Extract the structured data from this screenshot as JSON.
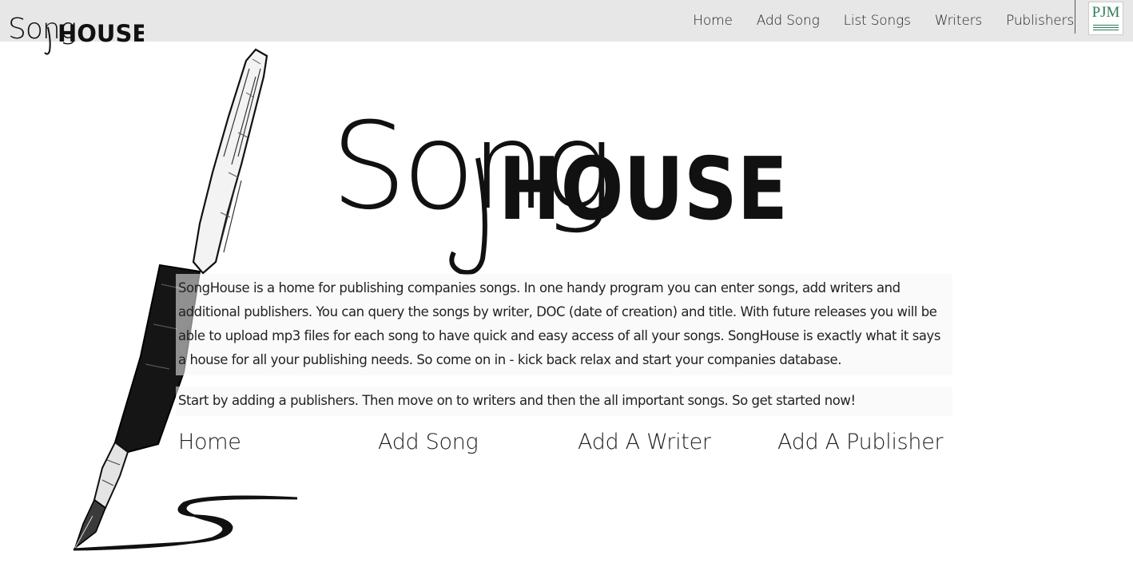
{
  "brand": {
    "logo_text_script": "Song",
    "logo_text_block": "HOUSE",
    "icon": "songhouse-logo"
  },
  "nav": {
    "items": [
      {
        "label": "Home"
      },
      {
        "label": "Add Song"
      },
      {
        "label": "List Songs"
      },
      {
        "label": "Writers"
      },
      {
        "label": "Publishers"
      }
    ],
    "partner_logo_text": "PJM"
  },
  "hero": {
    "logo_text_script": "Song",
    "logo_text_block": "HOUSE",
    "icon": "fountain-pen-illustration"
  },
  "intro": {
    "paragraph_1": "SongHouse is a home for publishing companies songs. In one handy program you can enter songs, add writers and additional publishers. You can query the songs by writer, DOC (date of creation) and title. With future releases you will be able to upload mp3 files for each song to have quick and easy access of all your songs. SongHouse is exactly what it says a house for all your publishing needs. So come on in - kick back relax and start your companies database.",
    "paragraph_2": "Start by adding a publishers. Then move on to writers and then the all important songs. So get started now!"
  },
  "bottom_links": {
    "home": "Home",
    "add_song": "Add Song",
    "add_writer": "Add A Writer",
    "add_publisher": "Add A Publisher"
  },
  "colors": {
    "navbar_bg": "#e7e7e7",
    "text": "#222222",
    "pjm_green": "#2f7d58"
  }
}
